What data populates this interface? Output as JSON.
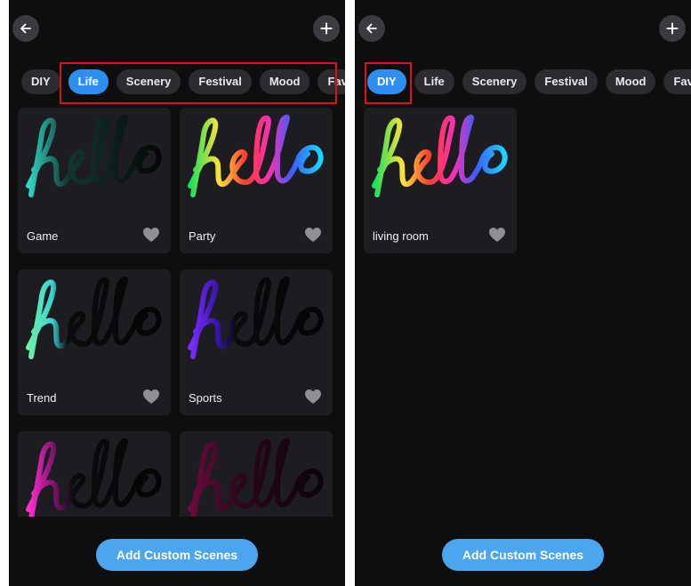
{
  "screens": [
    {
      "tabs": [
        "DIY",
        "Life",
        "Scenery",
        "Festival",
        "Mood",
        "Favo"
      ],
      "active_tab": "Life",
      "cards": [
        {
          "label": "Game",
          "style": "teal-dark"
        },
        {
          "label": "Party",
          "style": "rainbow"
        },
        {
          "label": "Trend",
          "style": "mint"
        },
        {
          "label": "Sports",
          "style": "violet"
        },
        {
          "label": "",
          "style": "magenta"
        },
        {
          "label": "",
          "style": "plum"
        }
      ],
      "add_button": "Add Custom Scenes"
    },
    {
      "tabs": [
        "DIY",
        "Life",
        "Scenery",
        "Festival",
        "Mood",
        "Favo"
      ],
      "active_tab": "DIY",
      "cards": [
        {
          "label": "living room",
          "style": "rainbow"
        }
      ],
      "add_button": "Add Custom Scenes"
    }
  ],
  "icons": {
    "back": "arrow-left-icon",
    "add": "plus-icon",
    "favorite": "heart-icon"
  },
  "colors": {
    "background": "#0e0e0f",
    "card": "#1d1d21",
    "tab": "#2c2c30",
    "tab_active": "#2f8ff0",
    "button": "#4ba6ef",
    "highlight": "#d9141d",
    "heart": "#8f8f95"
  }
}
